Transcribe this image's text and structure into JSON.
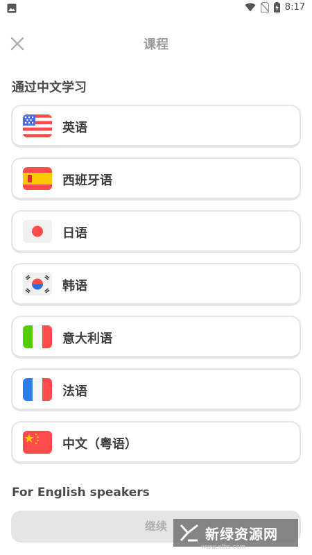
{
  "status_bar": {
    "time": "8:17",
    "icons": [
      "image-icon",
      "wifi-icon",
      "no-sim-icon",
      "battery-charging-icon"
    ]
  },
  "header": {
    "title": "课程",
    "close_icon": "close-icon"
  },
  "section_chinese": {
    "title": "通过中文学习"
  },
  "courses": [
    {
      "label": "英语",
      "flag": "us-flag-icon"
    },
    {
      "label": "西班牙语",
      "flag": "spain-flag-icon"
    },
    {
      "label": "日语",
      "flag": "japan-flag-icon"
    },
    {
      "label": "韩语",
      "flag": "korea-flag-icon"
    },
    {
      "label": "意大利语",
      "flag": "italy-flag-icon"
    },
    {
      "label": "法语",
      "flag": "france-flag-icon"
    },
    {
      "label": "中文（粤语）",
      "flag": "china-flag-icon"
    }
  ],
  "section_english": {
    "title": "For English speakers"
  },
  "footer": {
    "continue_label": "继续"
  },
  "watermark": {
    "text": "新绿资源网",
    "url": "www.xlhs.com"
  },
  "colors": {
    "card_border": "#e5e5e5",
    "button_disabled_bg": "#e5e5e5",
    "button_disabled_text": "#afafaf",
    "title_gray": "#9a9a9a"
  }
}
